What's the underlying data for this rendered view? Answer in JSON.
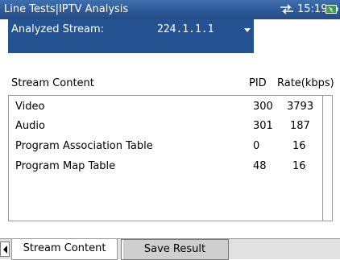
{
  "titlebar": {
    "title": "Line Tests|IPTV Analysis",
    "time": "15:19",
    "network_icon": "network-activity-icon",
    "battery_icon": "battery-icon",
    "color": "#2e5a97"
  },
  "stream_select": {
    "label": "Analyzed Stream:",
    "value": "224.1.1.1",
    "color": "#255392"
  },
  "table": {
    "headers": {
      "content": "Stream Content",
      "pid": "PID",
      "rate": "Rate(kbps)"
    },
    "rows": [
      {
        "content": "Video",
        "pid": "300",
        "rate": "3793"
      },
      {
        "content": "Audio",
        "pid": "301",
        "rate": "187"
      },
      {
        "content": "Program Association Table",
        "pid": "0",
        "rate": "16"
      },
      {
        "content": "Program Map Table",
        "pid": "48",
        "rate": "16"
      }
    ]
  },
  "tabs": [
    {
      "label": "Stream Content",
      "active": true
    },
    {
      "label": "Save Result",
      "active": false
    }
  ]
}
